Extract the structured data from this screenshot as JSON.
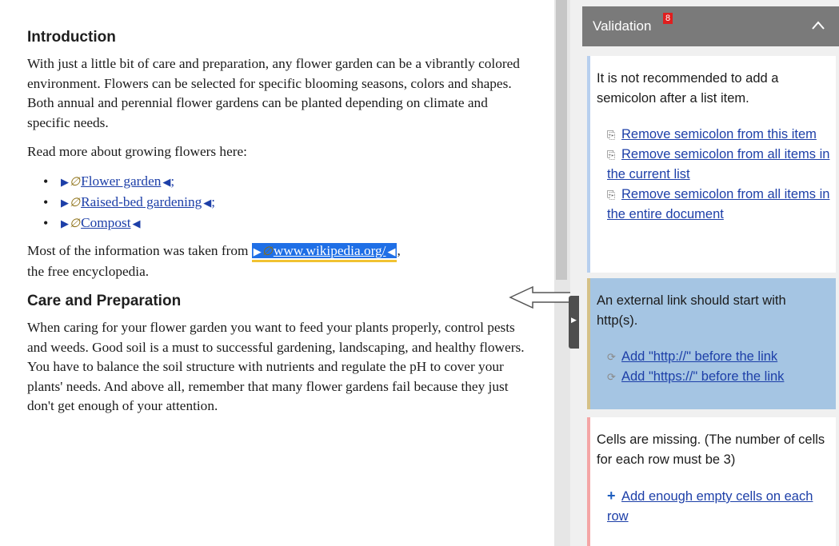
{
  "document": {
    "heading1": "Introduction",
    "para1": "With just a little bit of care and preparation, any flower garden can be a vibrantly colored environment. Flowers can be selected for specific blooming seasons, colors and shapes. Both annual and perennial flower gardens can be planted depending on climate and specific needs.",
    "para2": "Read more about growing flowers here:",
    "list": [
      {
        "text": "Flower garden",
        "suffix": ";"
      },
      {
        "text": "Raised-bed gardening",
        "suffix": ";"
      },
      {
        "text": "Compost",
        "suffix": ""
      }
    ],
    "para3_before": "Most of the information was taken from ",
    "para3_link": "www.wikipedia.org/",
    "para3_after": ",",
    "para3_line2": "the free encyclopedia.",
    "heading2": "Care and Preparation",
    "para4": "When caring for your flower garden you want to feed your plants properly, control pests and weeds. Good soil is a must to successful gardening, landscaping, and healthy flowers. You have to balance the soil structure with nutrients and regulate the pH to cover your plants' needs. And above all, remember that many flower gardens fail because they just don't get enough of your attention.",
    "tag_start_glyph": "▶",
    "tag_end_glyph": "◀",
    "pin_glyph": "∅"
  },
  "validation": {
    "title": "Validation",
    "count": "8",
    "cards": [
      {
        "message": "It is not recommended to add a semicolon after a list item.",
        "actions": [
          "Remove semicolon from this item",
          "Remove semicolon from all items in the current list",
          "Remove semicolon from all items in the entire document"
        ]
      },
      {
        "message": "An external link should start with http(s).",
        "actions": [
          "Add \"http://\" before the link",
          "Add \"https://\" before the link"
        ]
      },
      {
        "message": "Cells are missing. (The number of cells for each row must be 3)",
        "actions": [
          "Add enough empty cells on each row"
        ]
      }
    ]
  },
  "colors": {
    "highlight": "#1f6fe6",
    "panel_header": "#7a7a7a",
    "badge": "#e01e1e",
    "link": "#1d3fa8"
  }
}
